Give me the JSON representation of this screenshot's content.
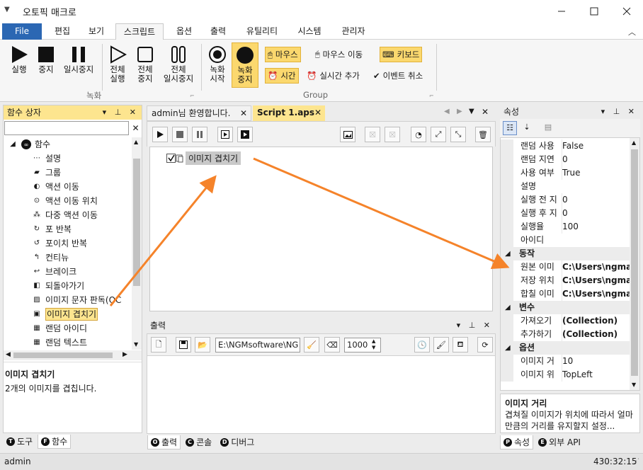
{
  "window": {
    "title": "오토픽 매크로"
  },
  "menu": {
    "file": "File",
    "items": [
      "편집",
      "보기",
      "스크립트",
      "옵션",
      "출력",
      "유틸리티",
      "시스템",
      "관리자"
    ],
    "active": "스크립트"
  },
  "ribbon": {
    "record_group": {
      "label": "녹화",
      "run": "실행",
      "stop": "중지",
      "pause": "일시중지",
      "run_all_1": "전체",
      "run_all_2": "실행",
      "stop_all_1": "전체",
      "stop_all_2": "중지",
      "pause_all_1": "전체",
      "pause_all_2": "일시중지"
    },
    "group": {
      "label": "Group",
      "rec_start_1": "녹화",
      "rec_start_2": "시작",
      "rec_stop_1": "녹화",
      "rec_stop_2": "중지",
      "mouse": "마우스",
      "mouse_move": "마우스 이동",
      "keyboard": "키보드",
      "time": "시간",
      "realtime_add": "실시간 추가",
      "event_cancel": "이벤트 취소"
    }
  },
  "left_panel": {
    "title": "함수 상자",
    "tree_root": "함수",
    "items": [
      "설명",
      "그룹",
      "액션 이동",
      "액션 이동 위치",
      "다중 액션 이동",
      "포 반복",
      "포이치 반복",
      "컨티뉴",
      "브레이크",
      "되돌아가기",
      "이미지 문자 판독(OC",
      "이미지 겹치기",
      "랜덤 아이디",
      "랜덤 텍스트"
    ],
    "selected": "이미지 겹치기",
    "desc_title": "이미지 겹치기",
    "desc_text": "2개의 이미지를 겹칩니다.",
    "tabs": [
      {
        "letter": "T",
        "label": "도구"
      },
      {
        "letter": "F",
        "label": "함수"
      }
    ]
  },
  "documents": {
    "tabs": [
      "admin님 환영합니다.",
      "Script 1.aps"
    ],
    "active": "Script 1.aps",
    "script_items": [
      "이미지 겹치기"
    ]
  },
  "output": {
    "title": "출력",
    "path": "E:\\NGMsoftware\\NG",
    "number": "1000",
    "tabs": [
      {
        "letter": "O",
        "label": "출력"
      },
      {
        "letter": "C",
        "label": "콘솔"
      },
      {
        "letter": "D",
        "label": "디버그"
      }
    ]
  },
  "properties": {
    "title": "속성",
    "rows": [
      {
        "type": "row",
        "name": "랜덤 사용",
        "value": "False"
      },
      {
        "type": "row",
        "name": "랜덤 지연",
        "value": "0"
      },
      {
        "type": "row",
        "name": "사용 여부",
        "value": "True"
      },
      {
        "type": "row",
        "name": "설명",
        "value": ""
      },
      {
        "type": "row",
        "name": "실행 전 지",
        "value": "0"
      },
      {
        "type": "row",
        "name": "실행 후 지",
        "value": "0"
      },
      {
        "type": "row",
        "name": "실행율",
        "value": "100"
      },
      {
        "type": "row",
        "name": "아이디",
        "value": ""
      },
      {
        "type": "cat",
        "name": "동작"
      },
      {
        "type": "row",
        "name": "원본 이미",
        "value": "C:\\Users\\ngma",
        "bold": true
      },
      {
        "type": "row",
        "name": "저장 위치",
        "value": "C:\\Users\\ngma",
        "bold": true
      },
      {
        "type": "row",
        "name": "합칠 이미",
        "value": "C:\\Users\\ngma",
        "bold": true
      },
      {
        "type": "cat",
        "name": "변수"
      },
      {
        "type": "row",
        "name": "가져오기",
        "value": "(Collection)",
        "bold": true
      },
      {
        "type": "row",
        "name": "추가하기",
        "value": "(Collection)",
        "bold": true
      },
      {
        "type": "cat",
        "name": "옵션"
      },
      {
        "type": "row",
        "name": "이미지 거",
        "value": "10"
      },
      {
        "type": "row",
        "name": "이미지 위",
        "value": "TopLeft"
      }
    ],
    "desc_title": "이미지 거리",
    "desc_text": "겹쳐질 이미지가 위치에 따라서 얼마만큼의 거리를 유지할지 설정...",
    "tabs": [
      {
        "letter": "P",
        "label": "속성"
      },
      {
        "letter": "E",
        "label": "외부 API"
      }
    ]
  },
  "status": {
    "user": "admin",
    "time": "430:32:15"
  },
  "colors": {
    "accent": "#2b67b3",
    "highlight": "#fbd86e",
    "arrow": "#f5832a"
  }
}
